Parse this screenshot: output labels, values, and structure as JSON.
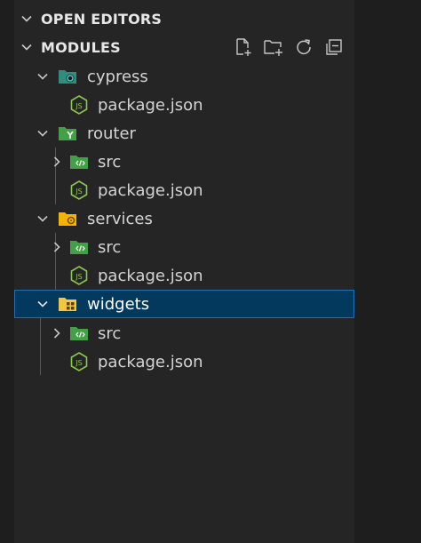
{
  "explorer": {
    "open_editors_label": "OPEN EDITORS",
    "modules_label": "MODULES",
    "actions": [
      "new-file-icon",
      "new-folder-icon",
      "refresh-icon",
      "collapse-all-icon"
    ],
    "tree": {
      "cypress": {
        "label": "cypress",
        "package": "package.json"
      },
      "router": {
        "label": "router",
        "src": "src",
        "package": "package.json"
      },
      "services": {
        "label": "services",
        "src": "src",
        "package": "package.json"
      },
      "widgets": {
        "label": "widgets",
        "src": "src",
        "package": "package.json"
      }
    }
  },
  "colors": {
    "selection_bg": "#04395e",
    "folder_green": "#4caf50",
    "folder_yellow": "#f4c542",
    "node_icon": "#8cc84b"
  }
}
